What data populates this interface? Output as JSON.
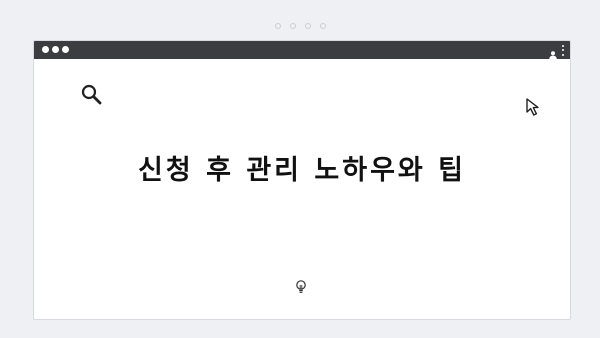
{
  "page_indicator": {
    "dots": [
      1,
      2,
      3,
      4
    ]
  },
  "window": {
    "titlebar": {
      "buttons": [
        "close",
        "minimize",
        "maximize"
      ],
      "right_icons": [
        "person-icon",
        "kebab-menu-icon"
      ]
    },
    "icons": {
      "search": "search-icon",
      "cursor": "cursor-arrow-icon",
      "bulb": "lightbulb-icon"
    },
    "headline": "신청 후 관리 노하우와 팁"
  },
  "colors": {
    "background": "#eef0f3",
    "titlebar": "#3b3d40",
    "window": "#ffffff",
    "text": "#111111"
  }
}
